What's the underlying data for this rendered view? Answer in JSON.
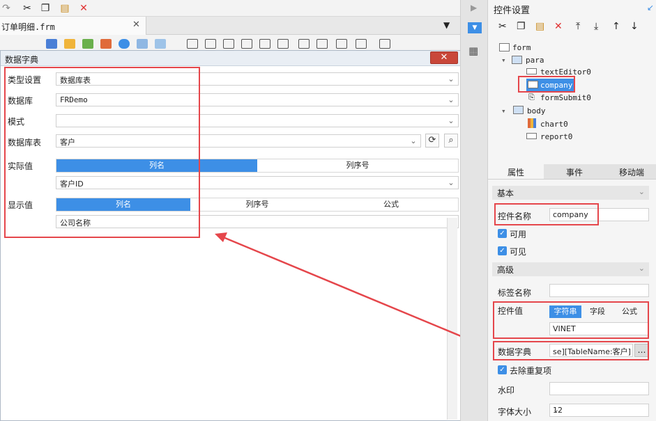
{
  "toolbar": {
    "icons": [
      "undo-icon",
      "cut-icon",
      "copy-icon",
      "paste-icon",
      "delete-icon"
    ]
  },
  "file_tab": {
    "label": "订单明细.frm",
    "close": "✕"
  },
  "dialog": {
    "title": "数据字典",
    "close": "✕",
    "type_label": "类型设置",
    "type_value": "数据库表",
    "db_label": "数据库",
    "db_value": "FRDemo",
    "schema_label": "模式",
    "schema_value": "",
    "table_label": "数据库表",
    "table_value": "客户",
    "actual_label": "实际值",
    "actual_tabs": [
      "列名",
      "列序号"
    ],
    "actual_value": "客户ID",
    "display_label": "显示值",
    "display_tabs": [
      "列名",
      "列序号",
      "公式"
    ],
    "display_value": "公司名称"
  },
  "panel": {
    "title": "控件设置",
    "tree": {
      "form": "form",
      "para": "para",
      "textEditor": "textEditor0",
      "company": "company",
      "formSubmit": "formSubmit0",
      "body": "body",
      "chart": "chart0",
      "report": "report0"
    },
    "tabs": [
      "属性",
      "事件",
      "移动端"
    ],
    "basic": "基本",
    "name_label": "控件名称",
    "name_value": "company",
    "enabled": "可用",
    "visible": "可见",
    "advanced": "高级",
    "tag_label": "标签名称",
    "tag_value": "",
    "value_label": "控件值",
    "value_tabs": [
      "字符串",
      "字段",
      "公式"
    ],
    "value_value": "VINET",
    "dict_label": "数据字典",
    "dict_value": "se][TableName:客户]",
    "dict_btn": "…",
    "dedupe": "去除重复项",
    "watermark_label": "水印",
    "watermark_value": "",
    "fontsize_label": "字体大小",
    "fontsize_value": "12"
  },
  "colors": {
    "accent": "#3d8fe6",
    "highlight": "#e5464b"
  }
}
